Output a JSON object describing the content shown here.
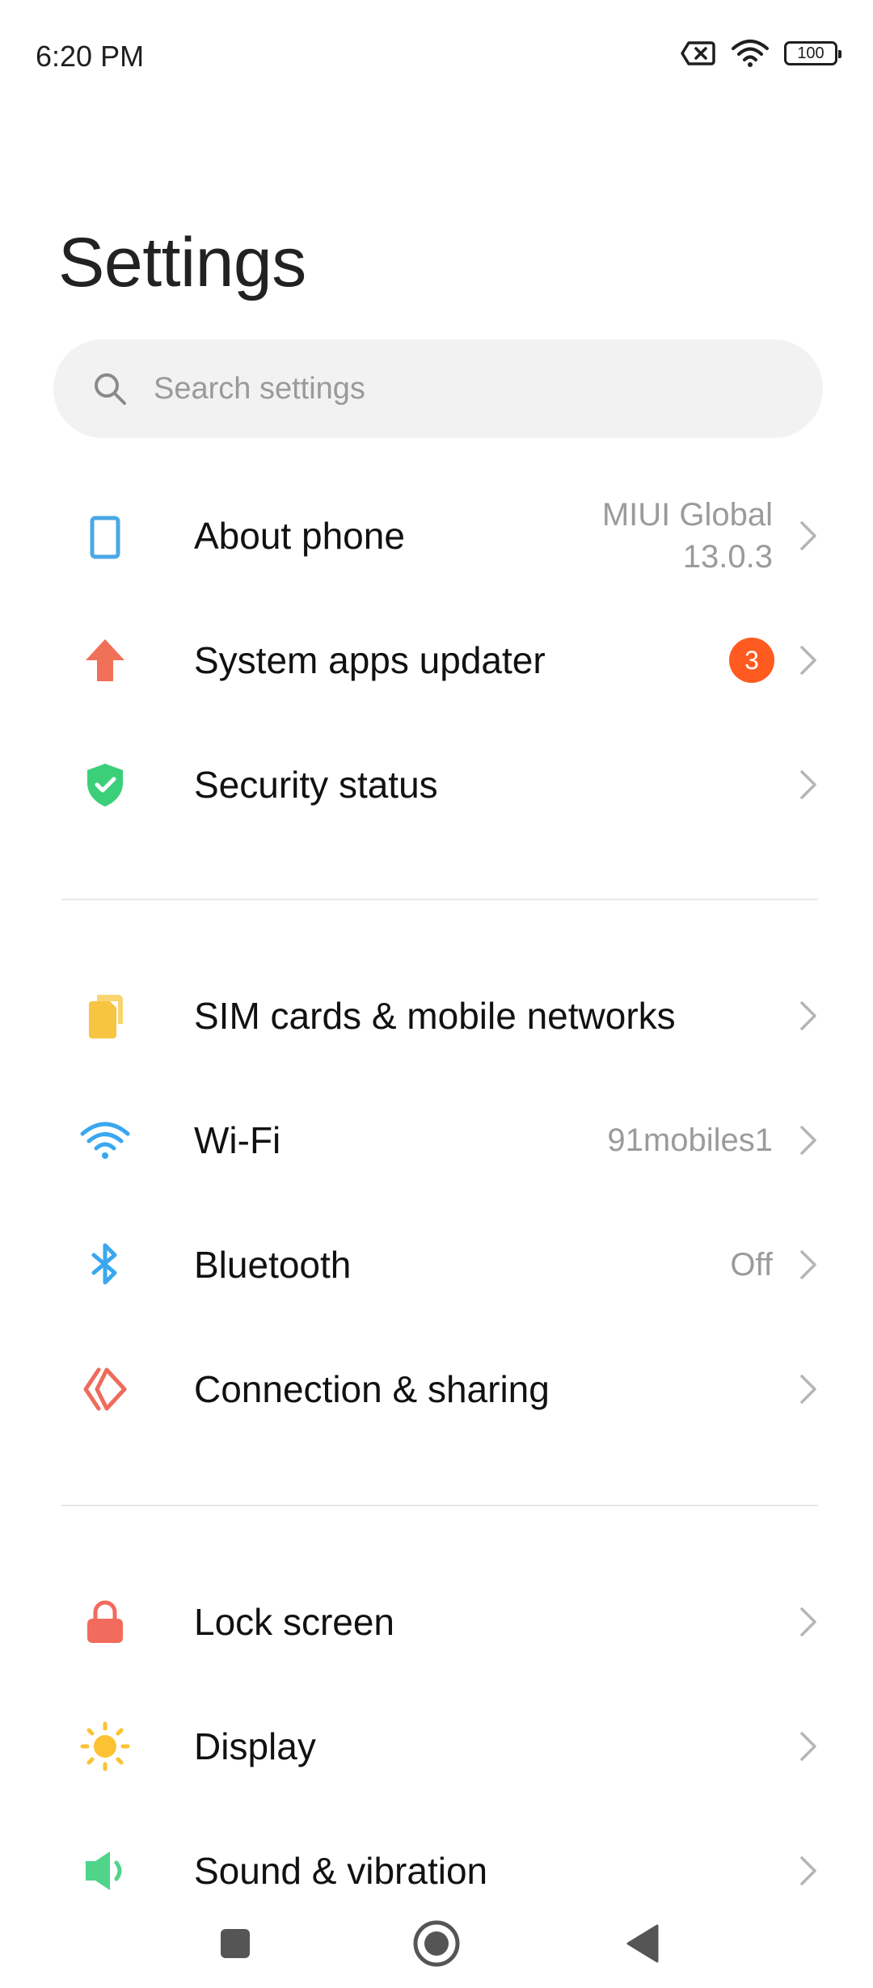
{
  "status_bar": {
    "time": "6:20 PM",
    "battery": "100",
    "icons": [
      "sim-off-icon",
      "wifi-icon",
      "battery-icon"
    ]
  },
  "page": {
    "title": "Settings"
  },
  "search": {
    "placeholder": "Search settings"
  },
  "colors": {
    "about": "#4aa8e6",
    "updater": "#f07058",
    "security": "#3ccf7a",
    "sim": "#f8c542",
    "wifi": "#3aa7f0",
    "bluetooth": "#3aa7f0",
    "connection": "#ee6b5b",
    "lock": "#f26b5c",
    "display": "#fbc233",
    "sound": "#4fd48a",
    "badge": "#ff5a1f"
  },
  "sections": [
    {
      "items": [
        {
          "label": "About phone",
          "value_line1": "MIUI Global",
          "value_line2": "13.0.3",
          "icon": "phone-icon"
        },
        {
          "label": "System apps updater",
          "badge": "3",
          "icon": "arrow-up-icon"
        },
        {
          "label": "Security status",
          "icon": "shield-check-icon"
        }
      ]
    },
    {
      "items": [
        {
          "label": "SIM cards & mobile networks",
          "icon": "sim-card-icon"
        },
        {
          "label": "Wi-Fi",
          "value": "91mobiles1",
          "icon": "wifi-icon"
        },
        {
          "label": "Bluetooth",
          "value": "Off",
          "icon": "bluetooth-icon"
        },
        {
          "label": "Connection & sharing",
          "icon": "connection-sharing-icon"
        }
      ]
    },
    {
      "items": [
        {
          "label": "Lock screen",
          "icon": "lock-icon"
        },
        {
          "label": "Display",
          "icon": "sun-icon"
        },
        {
          "label": "Sound & vibration",
          "icon": "speaker-icon"
        }
      ]
    }
  ],
  "nav_bar": {
    "buttons": [
      "recents-button",
      "home-button",
      "back-button"
    ]
  }
}
